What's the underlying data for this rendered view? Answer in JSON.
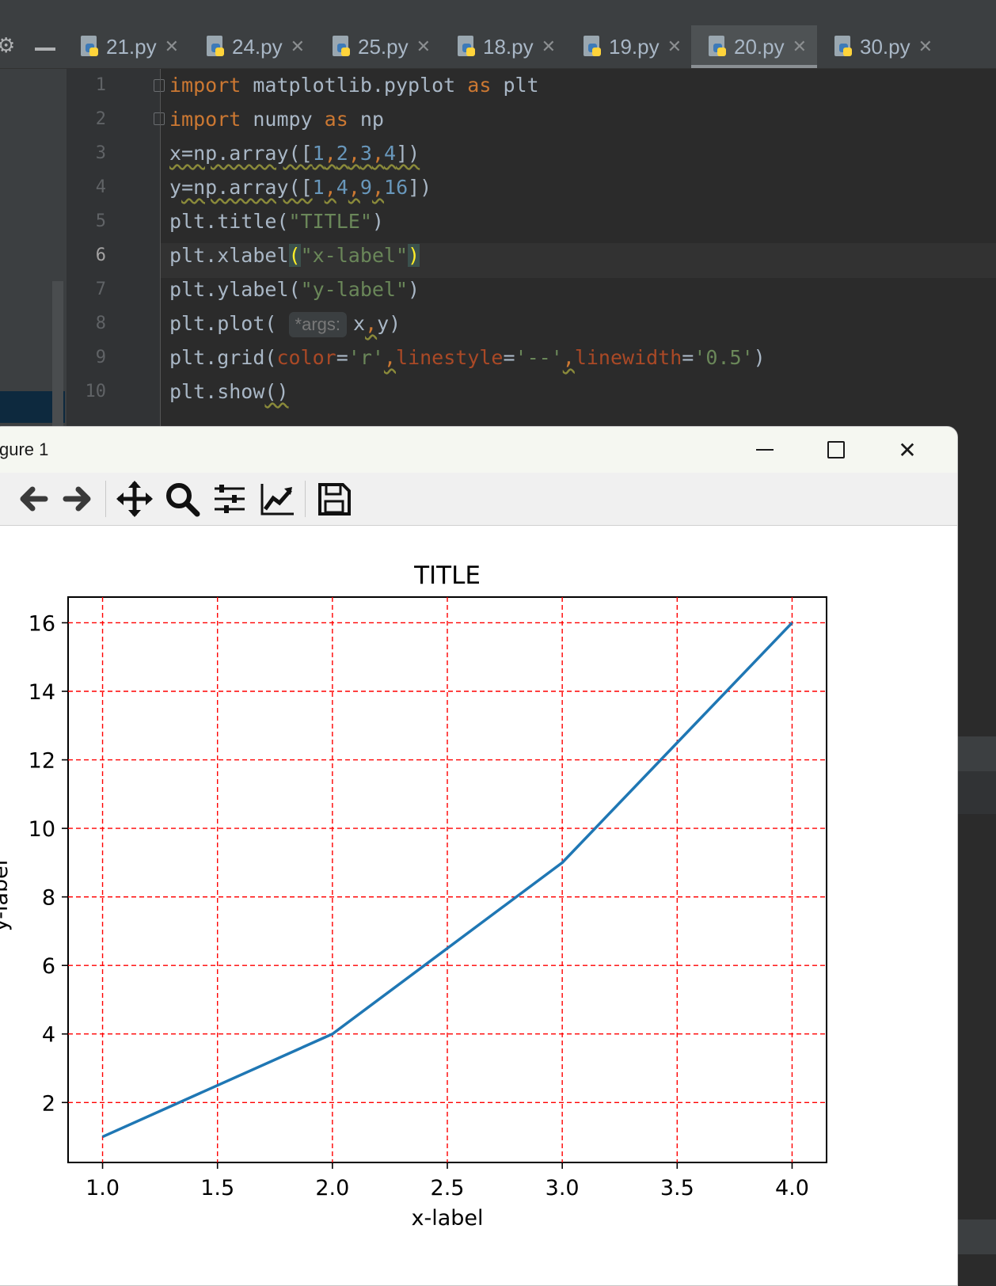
{
  "ide": {
    "tabs": [
      {
        "label": "21.py",
        "active": false
      },
      {
        "label": "24.py",
        "active": false
      },
      {
        "label": "25.py",
        "active": false
      },
      {
        "label": "18.py",
        "active": false
      },
      {
        "label": "19.py",
        "active": false
      },
      {
        "label": "20.py",
        "active": true
      },
      {
        "label": "30.py",
        "active": false
      }
    ],
    "line_numbers": [
      "1",
      "2",
      "3",
      "4",
      "5",
      "6",
      "7",
      "8",
      "9",
      "10"
    ],
    "current_line": "6",
    "code": {
      "l1_kw": "import",
      "l1_rest": " matplotlib.pyplot ",
      "l1_as": "as",
      "l1_alias": " plt",
      "l2_kw": "import",
      "l2_rest": " numpy ",
      "l2_as": "as",
      "l2_alias": " np",
      "l3_a": "x=np.array([",
      "l3_n1": "1",
      "l3_c1": ",",
      "l3_n2": "2",
      "l3_c2": ",",
      "l3_n3": "3",
      "l3_c3": ",",
      "l3_n4": "4",
      "l3_b": "])",
      "l4_a": "y",
      "l4_b": "=np.array([",
      "l4_n1": "1",
      "l4_c1": ",",
      "l4_n2": "4",
      "l4_c2": ",",
      "l4_n3": "9",
      "l4_c3": ",",
      "l4_n4": "16",
      "l4_e": "])",
      "l5_a": "plt.title(",
      "l5_s": "\"TITLE\"",
      "l5_b": ")",
      "l6_a": "plt.xlabel",
      "l6_p1": "(",
      "l6_s": "\"x-label\"",
      "l6_p2": ")",
      "l7_a": "plt.ylabel(",
      "l7_s": "\"y-label\"",
      "l7_b": ")",
      "l8_a": "plt.plot( ",
      "l8_hint": "*args:",
      "l8_x": "x",
      "l8_c": ",",
      "l8_y": "y)",
      "l9_a": "plt.grid(",
      "l9_p1": "color",
      "l9_eq1": "=",
      "l9_s1": "'r'",
      "l9_c1": ",",
      "l9_p2": "linestyle",
      "l9_eq2": "=",
      "l9_s2": "'--'",
      "l9_c2": ",",
      "l9_p3": "linewidth",
      "l9_eq3": "=",
      "l9_s3": "'0.5'",
      "l9_b": ")",
      "l10_a": "plt.show",
      "l10_b": "()"
    }
  },
  "figure_window": {
    "title": "gure 1",
    "toolbar_icons": [
      "back-icon",
      "forward-icon",
      "pan-icon",
      "zoom-icon",
      "configure-subplots-icon",
      "edit-axis-icon",
      "save-icon"
    ]
  },
  "chart_data": {
    "type": "line",
    "title": "TITLE",
    "xlabel": "x-label",
    "ylabel": "y-label",
    "x": [
      1,
      2,
      3,
      4
    ],
    "series": [
      {
        "values": [
          1,
          4,
          9,
          16
        ],
        "color": "#1f77b4"
      }
    ],
    "xlim": [
      0.85,
      4.15
    ],
    "ylim": [
      0.25,
      16.75
    ],
    "xticks": [
      "1.0",
      "1.5",
      "2.0",
      "2.5",
      "3.0",
      "3.5",
      "4.0"
    ],
    "yticks": [
      "2",
      "4",
      "6",
      "8",
      "10",
      "12",
      "14",
      "16"
    ],
    "grid": {
      "on": true,
      "color": "#ff0000",
      "linestyle": "--",
      "linewidth": "0.5"
    }
  }
}
